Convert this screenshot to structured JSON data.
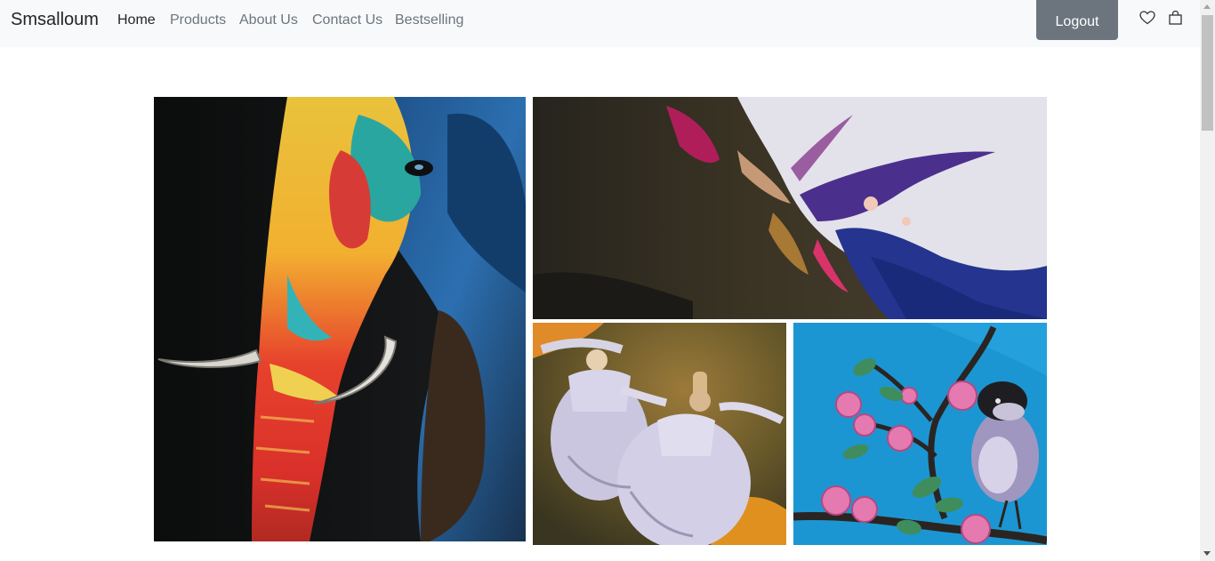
{
  "navbar": {
    "brand": "Smsalloum",
    "links": [
      {
        "label": "Home",
        "active": true
      },
      {
        "label": "Products",
        "active": false
      },
      {
        "label": "About Us",
        "active": false
      },
      {
        "label": "Contact Us",
        "active": false
      },
      {
        "label": "Bestselling",
        "active": false
      }
    ],
    "logout_label": "Logout",
    "icons": [
      "heart-icon",
      "shopping-bag-icon"
    ]
  },
  "gallery": {
    "items": [
      {
        "subject": "colorful-elephant-painting"
      },
      {
        "subject": "abstract-ink-painting"
      },
      {
        "subject": "whirling-dervishes-painting"
      },
      {
        "subject": "bird-on-blossom-branch-painting"
      }
    ]
  },
  "colors": {
    "navbar_bg": "#f8f9fa",
    "logout_bg": "#6c757d",
    "link_muted": "#6c757d",
    "link_active": "#212529"
  }
}
